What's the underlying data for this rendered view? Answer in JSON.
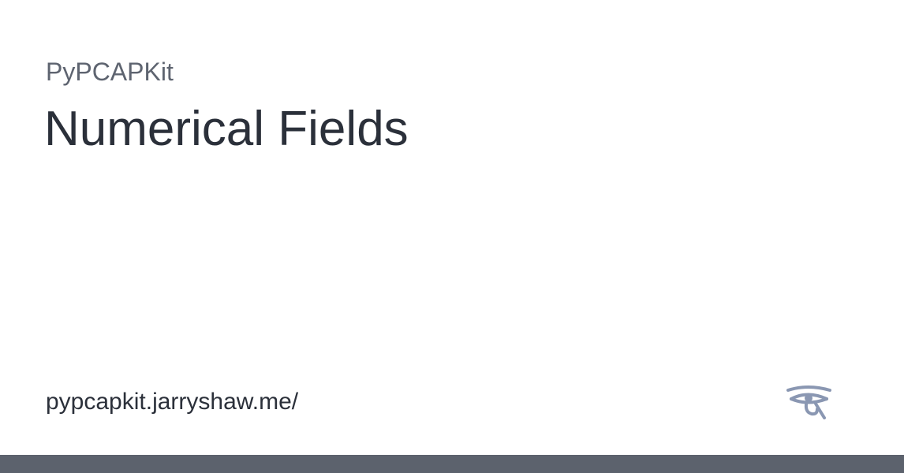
{
  "card": {
    "site_name": "PyPCAPKit",
    "page_title": "Numerical Fields",
    "site_url": "pypcapkit.jarryshaw.me/",
    "logo_icon": "eye-of-horus-icon"
  },
  "colors": {
    "site_name": "#5e6470",
    "title_text": "#2b303a",
    "logo": "#8a97b2",
    "bottom_bar": "#5c626d",
    "background": "#ffffff"
  }
}
